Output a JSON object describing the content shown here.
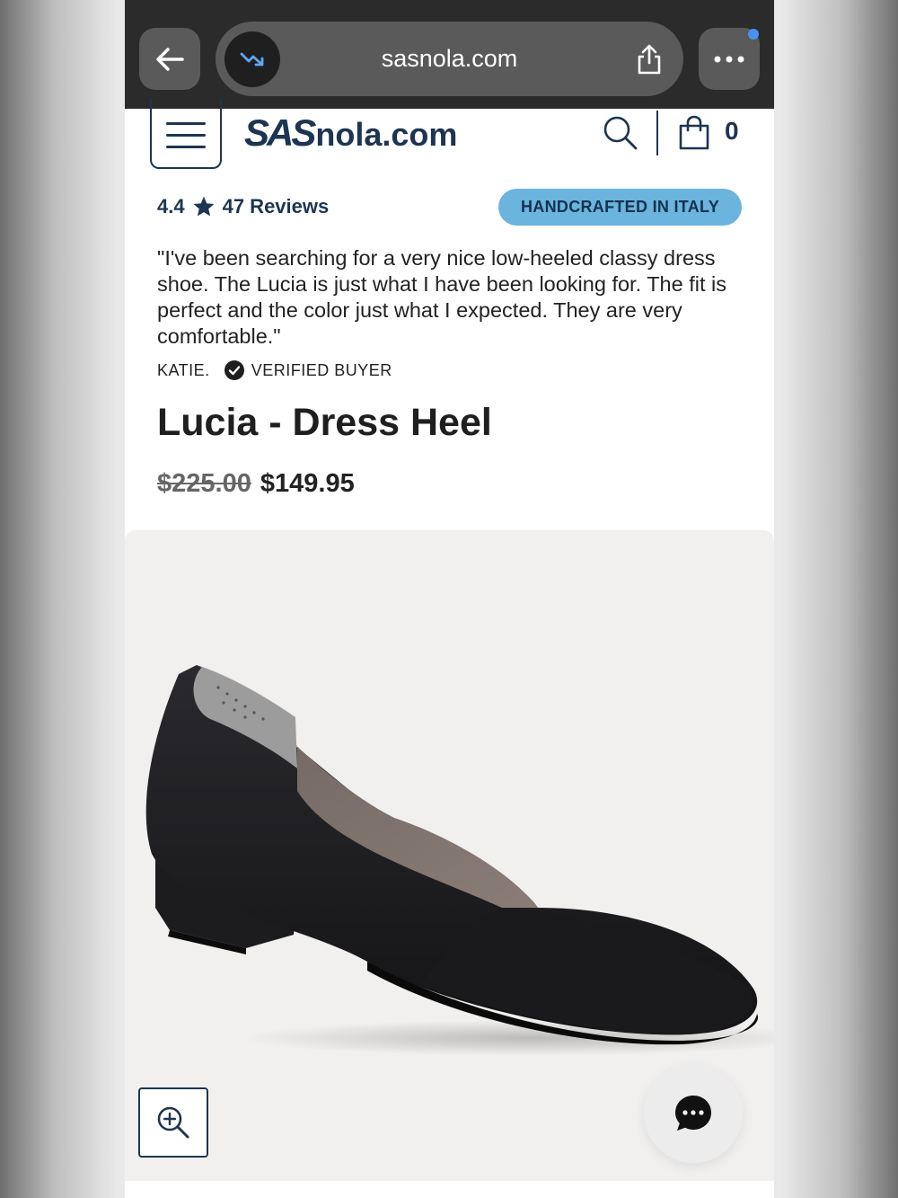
{
  "browser": {
    "url": "sasnola.com"
  },
  "header": {
    "logo_brand": "SAS",
    "logo_suffix": "nola.com",
    "cart_count": "0"
  },
  "rating": {
    "score": "4.4",
    "reviews": "47 Reviews"
  },
  "badge": "HANDCRAFTED IN ITALY",
  "review": {
    "quote": "\"I've been searching for a very nice low-heeled classy dress shoe. The Lucia is just what I have been looking for. The fit is perfect and the color just what I expected. They are very comfortable.\"",
    "author": "KATIE.",
    "verified": "VERIFIED BUYER"
  },
  "product": {
    "title": "Lucia - Dress Heel",
    "price_original": "$225.00",
    "price_sale": "$149.95"
  },
  "colors": {
    "navy": "#1d3552",
    "badge_bg": "#6ab4dd",
    "browser_bar": "#2b2b2b",
    "notification_dot": "#4a90f0"
  },
  "icons": [
    "back-arrow-icon",
    "trending-icon",
    "share-icon",
    "more-icon",
    "menu-icon",
    "search-icon",
    "shopping-bag-icon",
    "star-icon",
    "check-circle-icon",
    "zoom-in-icon",
    "chat-icon"
  ]
}
